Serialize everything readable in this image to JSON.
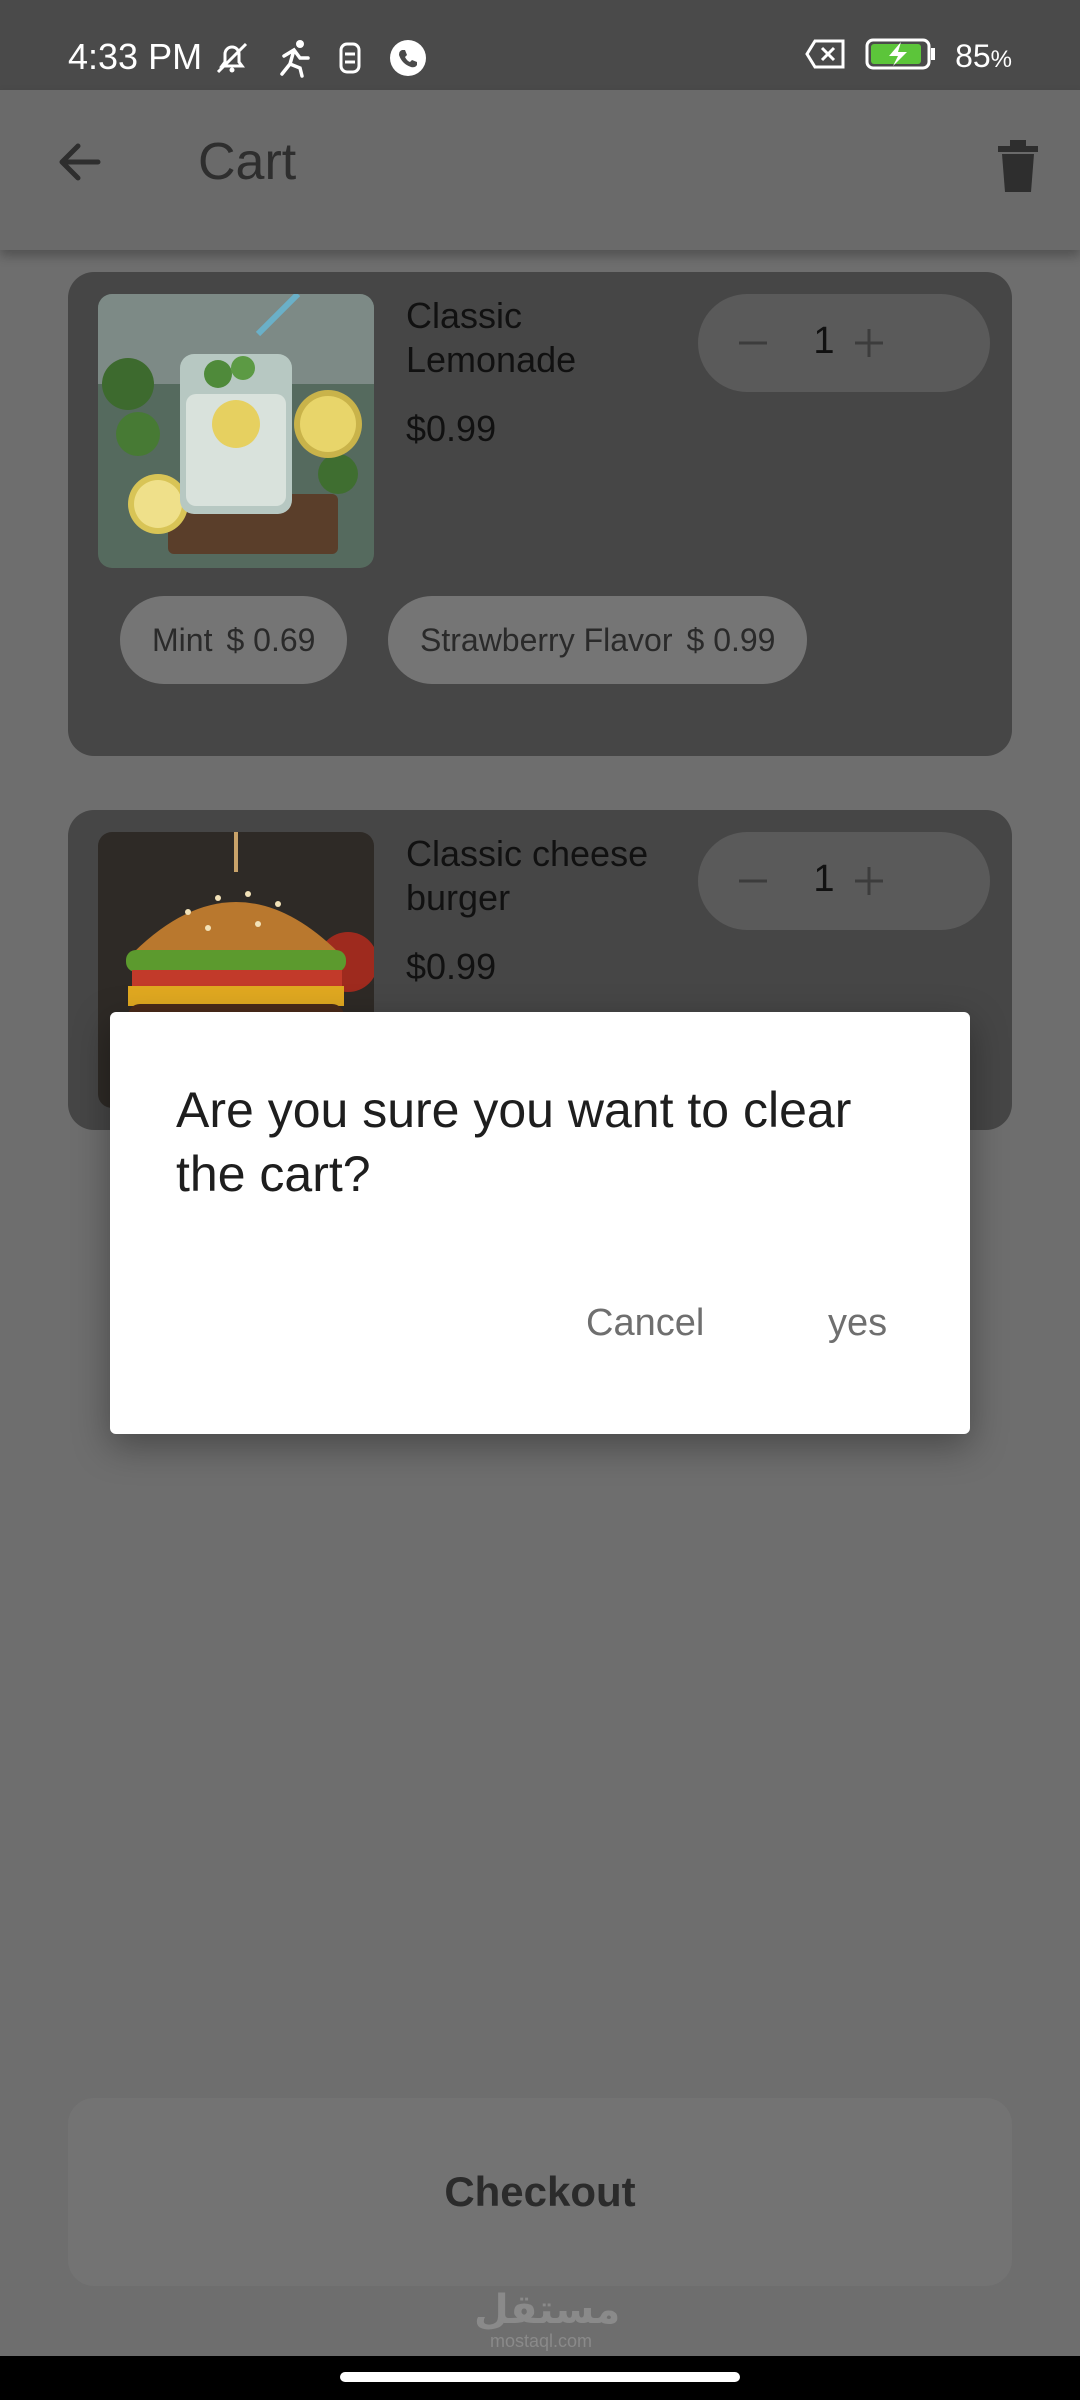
{
  "status_bar": {
    "time": "4:33 PM",
    "battery_percent": "85",
    "battery_unit": "%",
    "icons_left": [
      "mute-notifications-icon",
      "running-icon",
      "data-saver-icon",
      "phone-icon"
    ],
    "icons_right": [
      "no-sim-icon",
      "battery-charging-icon"
    ]
  },
  "app_bar": {
    "title": "Cart"
  },
  "cart_items": [
    {
      "name": "Classic Lemonade",
      "price": "$0.99",
      "quantity": "1",
      "addons": [
        {
          "name": "Mint",
          "price": "$ 0.69"
        },
        {
          "name": "Strawberry Flavor",
          "price": "$ 0.99"
        }
      ]
    },
    {
      "name": "Classic cheese burger",
      "price": "$0.99",
      "quantity": "1"
    }
  ],
  "checkout": {
    "label": "Checkout"
  },
  "dialog": {
    "title": "Are you sure you want to clear the cart?",
    "cancel_label": "Cancel",
    "confirm_label": "yes"
  },
  "watermark": {
    "arabic": "مستقل",
    "latin": "mostaql.com"
  },
  "colors": {
    "scrim_background": "#6e6e6e",
    "card_background": "#464646",
    "dialog_background": "#ffffff",
    "dialog_button_text": "#6f6f6f"
  }
}
